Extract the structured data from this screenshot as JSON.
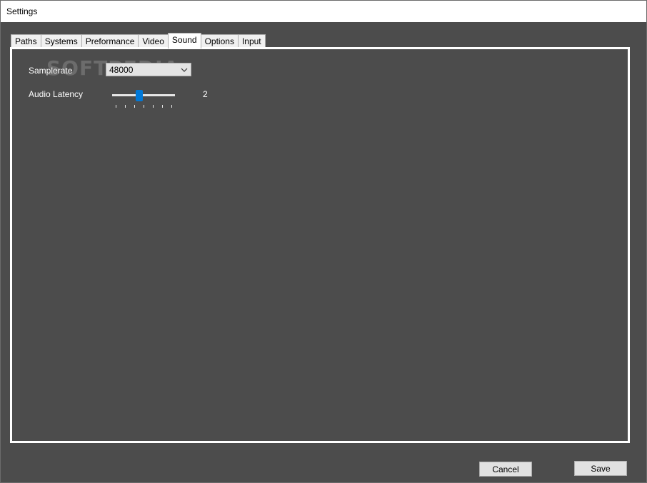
{
  "window": {
    "title": "Settings"
  },
  "tabs": [
    {
      "label": "Paths",
      "active": false
    },
    {
      "label": "Systems",
      "active": false
    },
    {
      "label": "Preformance",
      "active": false
    },
    {
      "label": "Video",
      "active": false
    },
    {
      "label": "Sound",
      "active": true
    },
    {
      "label": "Options",
      "active": false
    },
    {
      "label": "Input",
      "active": false
    }
  ],
  "sound": {
    "samplerate_label": "Samplerate",
    "samplerate_value": "48000",
    "latency_label": "Audio Latency",
    "latency_value": "2",
    "latency_min": 0,
    "latency_max": 6,
    "latency_level": 2
  },
  "watermark": {
    "text": "SOFTPEDIA",
    "mark": "®"
  },
  "buttons": {
    "cancel": "Cancel",
    "save": "Save"
  },
  "colors": {
    "accent": "#0078d7",
    "panel_bg": "#4c4c4c"
  }
}
